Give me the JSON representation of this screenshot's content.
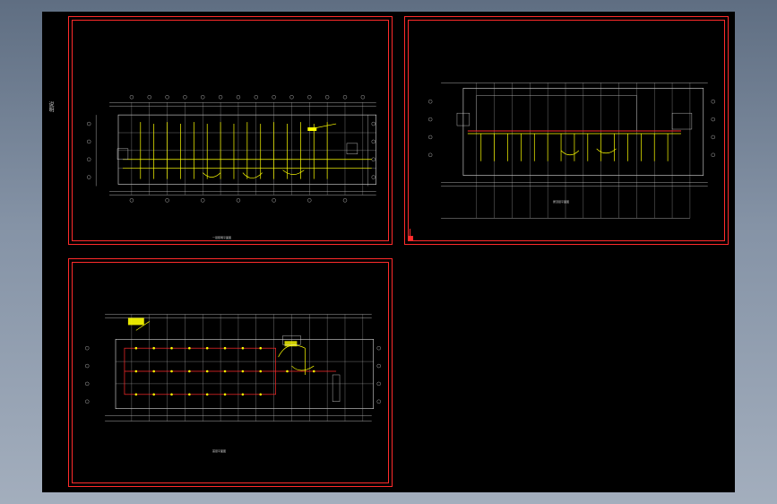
{
  "viewport": {
    "background": "#000000",
    "sheet_border_color": "#ff2b2b",
    "plan_line_color": "#e6e6e6",
    "wiring_color": "#ffff00",
    "accent_red": "#ff2b2b"
  },
  "side_text": "说明",
  "sheets": [
    {
      "name": "sheet-1",
      "caption": "一层照明平面图"
    },
    {
      "name": "sheet-2",
      "caption": "屋顶层平面图"
    },
    {
      "name": "sheet-3",
      "caption": "首层平面图"
    }
  ]
}
